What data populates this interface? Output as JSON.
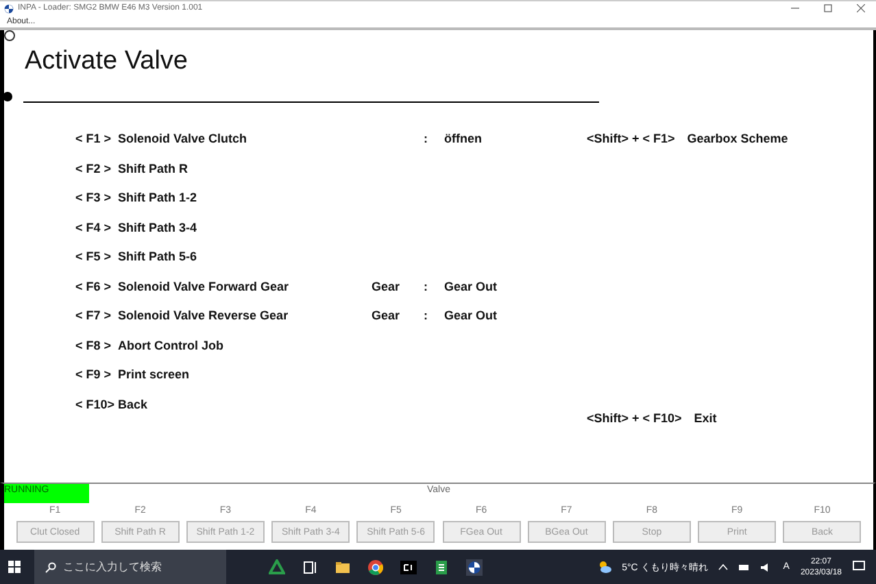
{
  "window": {
    "title": "INPA - Loader:  SMG2 BMW E46 M3 Version 1.001"
  },
  "menu": [
    "About..."
  ],
  "heading": "Activate Valve",
  "entries": [
    {
      "key": "< F1 >",
      "label": "Solenoid Valve Clutch",
      "separator": ":",
      "value": "öffnen"
    },
    {
      "key": "< F2 >",
      "label": "Shift Path R"
    },
    {
      "key": "< F3 >",
      "label": "Shift Path 1-2"
    },
    {
      "key": "< F4 >",
      "label": "Shift Path 3-4"
    },
    {
      "key": "< F5 >",
      "label": "Shift Path 5-6"
    },
    {
      "key": "< F6 >",
      "label": "Solenoid Valve Forward Gear",
      "column_3": "Gear",
      "separator": ":",
      "value": "Gear Out"
    },
    {
      "key": "< F7 >",
      "label": "Solenoid Valve Reverse Gear",
      "column_3": "Gear",
      "separator": ":",
      "value": "Gear Out"
    },
    {
      "key": "< F8 >",
      "label": "Abort Control Job"
    },
    {
      "key": "< F9 >",
      "label": "Print screen"
    },
    {
      "key": "< F10>",
      "label": "Back"
    }
  ],
  "shift_entries": [
    {
      "key": "<Shift> + < F1>",
      "label": "Gearbox Scheme"
    },
    {
      "key": "<Shift> + < F10>",
      "label": "Exit"
    }
  ],
  "status_bar": {
    "state": "RUNNING",
    "title": "Valve"
  },
  "function_keys": [
    {
      "key": "F1",
      "label": "Clut Closed"
    },
    {
      "key": "F2",
      "label": "Shift Path R"
    },
    {
      "key": "F3",
      "label": "Shift Path 1-2"
    },
    {
      "key": "F4",
      "label": "Shift Path 3-4"
    },
    {
      "key": "F5",
      "label": "Shift Path 5-6"
    },
    {
      "key": "F6",
      "label": "FGea Out"
    },
    {
      "key": "F7",
      "label": "BGea Out"
    },
    {
      "key": "F8",
      "label": "Stop"
    },
    {
      "key": "F9",
      "label": "Print"
    },
    {
      "key": "F10",
      "label": "Back"
    }
  ],
  "taskbar": {
    "search_placeholder": "ここに入力して検索",
    "weather": "5°C くもり時々晴れ",
    "input_mode": "A",
    "time": "22:07",
    "date": "2023/03/18"
  }
}
